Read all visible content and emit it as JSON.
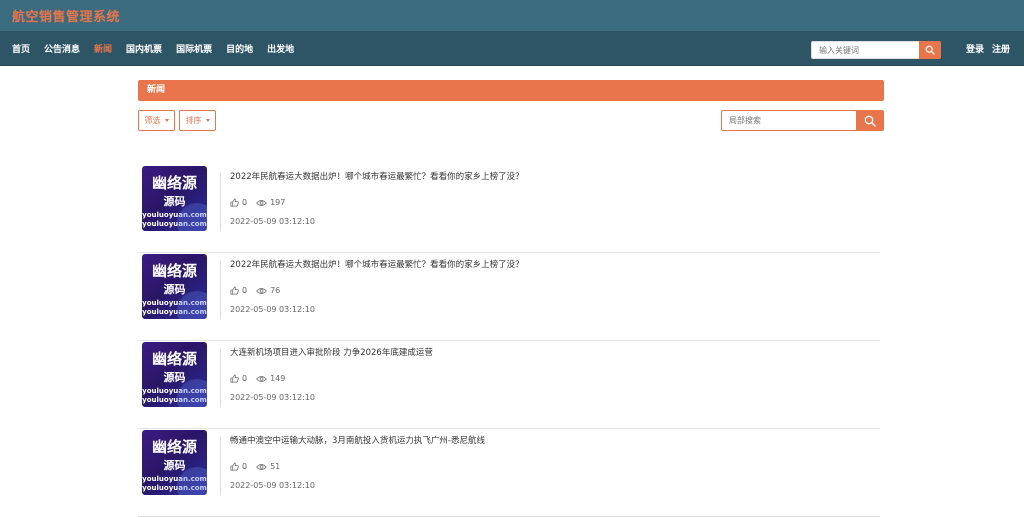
{
  "app": {
    "title": "航空销售管理系统"
  },
  "nav": {
    "items": [
      {
        "label": "首页",
        "active": false
      },
      {
        "label": "公告消息",
        "active": false
      },
      {
        "label": "新闻",
        "active": true
      },
      {
        "label": "国内机票",
        "active": false
      },
      {
        "label": "国际机票",
        "active": false
      },
      {
        "label": "目的地",
        "active": false
      },
      {
        "label": "出发地",
        "active": false
      }
    ],
    "search_placeholder": "输入关键词",
    "login": "登录",
    "register": "注册"
  },
  "section": {
    "title": "新闻"
  },
  "toolbar": {
    "filter_label": "筛选",
    "sort_label": "排序",
    "local_search_placeholder": "局部搜索"
  },
  "thumbnail": {
    "line1": "幽络源",
    "line2": "源码",
    "line3": "youluoyuan.com",
    "line4": "youluoyuan.com"
  },
  "news": [
    {
      "title": "2022年民航春运大数据出炉！哪个城市春运最繁忙？看看你的家乡上榜了没？",
      "likes": "0",
      "views": "197",
      "date": "2022-05-09 03:12:10"
    },
    {
      "title": "2022年民航春运大数据出炉！哪个城市春运最繁忙？看看你的家乡上榜了没？",
      "likes": "0",
      "views": "76",
      "date": "2022-05-09 03:12:10"
    },
    {
      "title": "大连新机场项目进入审批阶段 力争2026年底建成运营",
      "likes": "0",
      "views": "149",
      "date": "2022-05-09 03:12:10"
    },
    {
      "title": "畅通中澳空中运输大动脉，3月南航投入货机运力执飞广州-悉尼航线",
      "likes": "0",
      "views": "51",
      "date": "2022-05-09 03:12:10"
    }
  ],
  "colors": {
    "accent": "#e8754b",
    "topbar": "#3a6b7e",
    "navbar": "#2e5566"
  }
}
